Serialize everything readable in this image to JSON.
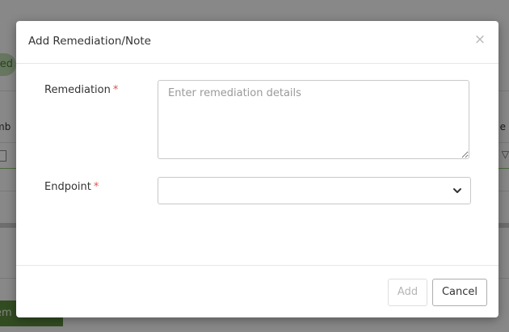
{
  "background": {
    "pill_text": "ed",
    "left_column_text": "mb",
    "right_column_text": "e",
    "green_button_text": "em"
  },
  "modal": {
    "title": "Add Remediation/Note",
    "close_symbol": "×",
    "remediation": {
      "label": "Remediation",
      "required_marker": "*",
      "placeholder": "Enter remediation details",
      "value": ""
    },
    "endpoint": {
      "label": "Endpoint",
      "required_marker": "*",
      "selected_value": ""
    },
    "buttons": {
      "add_label": "Add",
      "cancel_label": "Cancel"
    }
  },
  "colors": {
    "required": "#d9534f",
    "overlay": "rgba(0,0,0,0.45)",
    "background_green": "#5b8a3c"
  }
}
